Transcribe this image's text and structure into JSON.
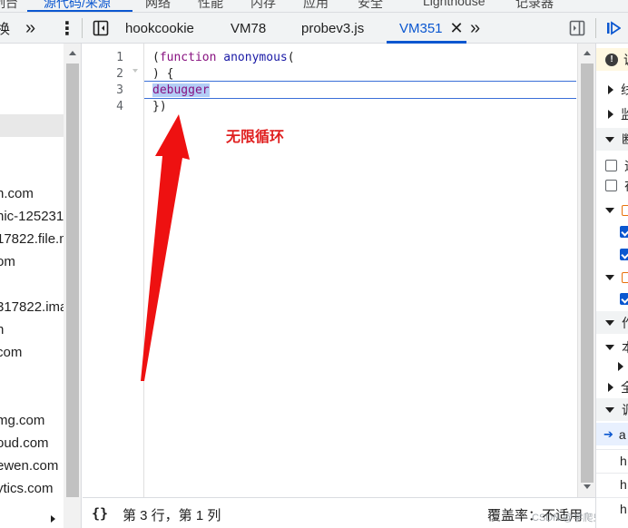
{
  "top_tabs": [
    {
      "label": "控制台"
    },
    {
      "label": "源代码/来源",
      "active": true
    },
    {
      "label": "网络"
    },
    {
      "label": "性能"
    },
    {
      "label": "内存"
    },
    {
      "label": "应用"
    },
    {
      "label": "安全"
    },
    {
      "label": "Lighthouse"
    },
    {
      "label": "记录器"
    }
  ],
  "toolbar": {
    "left_label": "换",
    "more_chevron": "»",
    "kebab": "⋮",
    "tabs": [
      {
        "label": "hookcookie"
      },
      {
        "label": "VM78"
      },
      {
        "label": "probev3.js"
      },
      {
        "label": "VM351",
        "active": true,
        "close": "✕"
      }
    ],
    "tabs_more": "»"
  },
  "file_tree": {
    "items": [
      "n.com",
      "nic-125231",
      "17822.file.m",
      "om",
      "317822.ima",
      "n",
      "com",
      "mg.com",
      "oud.com",
      "ewen.com",
      "ytics.com"
    ]
  },
  "editor": {
    "line_numbers": [
      "1",
      "2",
      "3",
      "4"
    ],
    "lines": {
      "l1_paren": "(",
      "l1_kw": "function",
      "l1_name": "anonymous",
      "l1_end": "(",
      "l2": ") {",
      "l3": "debugger",
      "l4": "})"
    },
    "annotation": "无限循环",
    "arrow_color": "#e02020"
  },
  "status_bar": {
    "braces": "{}",
    "position": "第 3 行，第 1 列",
    "coverage": "覆盖率：不适用",
    "watermark": "CSDN @学爬虫"
  },
  "right_pane": {
    "rows": [
      {
        "type": "warn",
        "text": "调"
      },
      {
        "type": "collapsed",
        "text": "线"
      },
      {
        "type": "collapsed",
        "text": "监"
      },
      {
        "type": "expanded",
        "text": "断"
      },
      {
        "type": "checkbox",
        "checked": false,
        "text": "遇"
      },
      {
        "type": "checkbox",
        "checked": false,
        "text": "在"
      },
      {
        "type": "bp-group",
        "text": "<"
      },
      {
        "type": "checkbox",
        "checked": true,
        "text": ""
      },
      {
        "type": "checkbox",
        "checked": true,
        "text": ""
      },
      {
        "type": "bp-group",
        "text": "<"
      },
      {
        "type": "checkbox",
        "checked": true,
        "text": ""
      },
      {
        "type": "expanded",
        "text": "作"
      },
      {
        "type": "expanded",
        "text": "本"
      },
      {
        "type": "collapsed",
        "text": ""
      },
      {
        "type": "collapsed",
        "text": "全"
      },
      {
        "type": "expanded",
        "text": "调"
      },
      {
        "type": "current",
        "text": "a"
      },
      {
        "type": "plain",
        "text": "h"
      },
      {
        "type": "plain",
        "text": "h"
      },
      {
        "type": "plain",
        "text": "h"
      }
    ]
  },
  "colors": {
    "accent": "#0b57d0",
    "keyword": "#881280",
    "annotation_red": "#e02020",
    "selection": "#b3cdf6"
  }
}
